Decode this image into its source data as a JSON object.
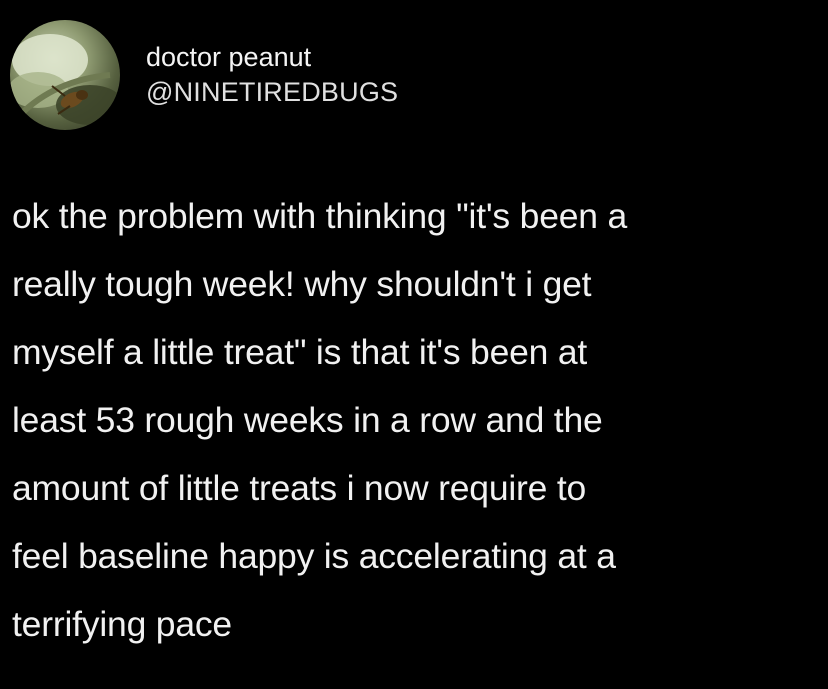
{
  "tweet": {
    "author": {
      "display_name": "doctor peanut",
      "handle": "@NINETIREDBUGS",
      "avatar_icon": "avatar-bug-on-leaf-icon"
    },
    "text": "ok the problem with thinking \"it's been a\nreally tough week! why shouldn't i get\nmyself a little treat\" is that it's been at\nleast 53 rough weeks in a row and the\namount of little treats i now require to\nfeel baseline happy is accelerating at a\nterrifying pace"
  },
  "colors": {
    "background": "#000000",
    "text": "#f1f1f1"
  }
}
